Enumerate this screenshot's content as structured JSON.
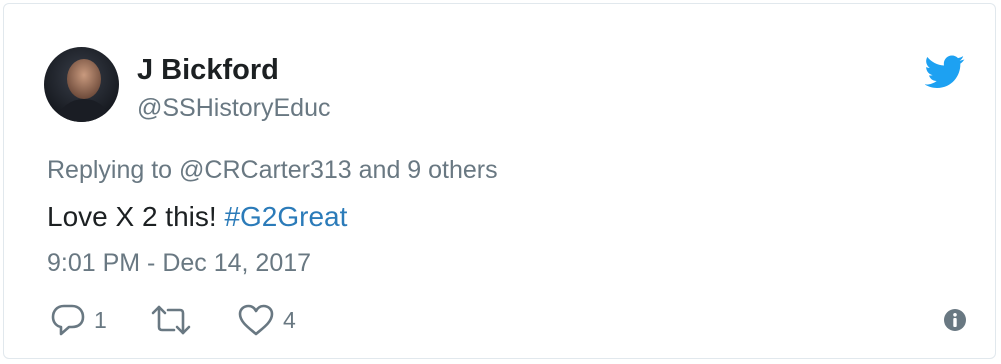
{
  "author": {
    "name": "J Bickford",
    "handle": "@SSHistoryEduc"
  },
  "replying": {
    "prefix": "Replying to",
    "mention": "@CRCarter313",
    "suffix": "and 9 others"
  },
  "tweet": {
    "text": "Love X 2 this!",
    "hashtag": "#G2Great"
  },
  "timestamp": "9:01 PM - Dec 14, 2017",
  "actions": {
    "reply_count": "1",
    "retweet_count": "",
    "like_count": "4"
  },
  "colors": {
    "accent": "#1da1f2",
    "hashtag": "#2b7bb9",
    "muted": "#697882"
  },
  "icons": {
    "brand": "twitter-bird-icon",
    "reply": "reply-icon",
    "retweet": "retweet-icon",
    "like": "heart-icon",
    "info": "info-icon"
  }
}
